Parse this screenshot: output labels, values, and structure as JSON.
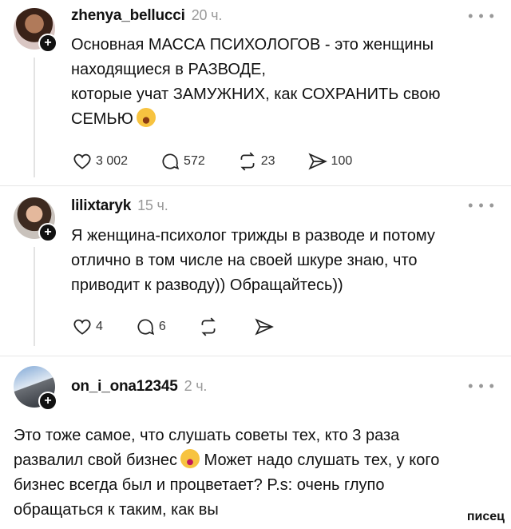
{
  "posts": [
    {
      "username": "zhenya_bellucci",
      "time": "20 ч.",
      "text": "Основная МАССА ПСИХОЛОГОВ - это женщины\nнаходящиеся в РАЗВОДЕ,\nкоторые учат ЗАМУЖНИХ, как СОХРАНИТЬ свою\nСЕМЬЮ",
      "emoji_icon": "hushed-face-emoji",
      "likes": "3 002",
      "comments": "572",
      "reposts": "23",
      "shares": "100"
    },
    {
      "username": "lilixtaryk",
      "time": "15 ч.",
      "text": "Я женщина-психолог трижды в разводе и потому\nотлично в том числе на своей шкуре знаю, что\nприводит к разводу)) Обращайтесь))",
      "likes": "4",
      "comments": "6"
    },
    {
      "username": "on_i_ona12345",
      "time": "2 ч.",
      "text_part1": "Это тоже самое, что слушать советы тех, кто 3 раза\nразвалил свой бизнес",
      "emoji_icon": "laughing-face-emoji",
      "text_part2": " Может надо слушать тех, у кого\nбизнес всегда был и процветает? P.s: очень глупо\nобращаться к таким, как вы"
    }
  ],
  "more_label": "• • •",
  "follow_label": "+",
  "watermark": "писец"
}
